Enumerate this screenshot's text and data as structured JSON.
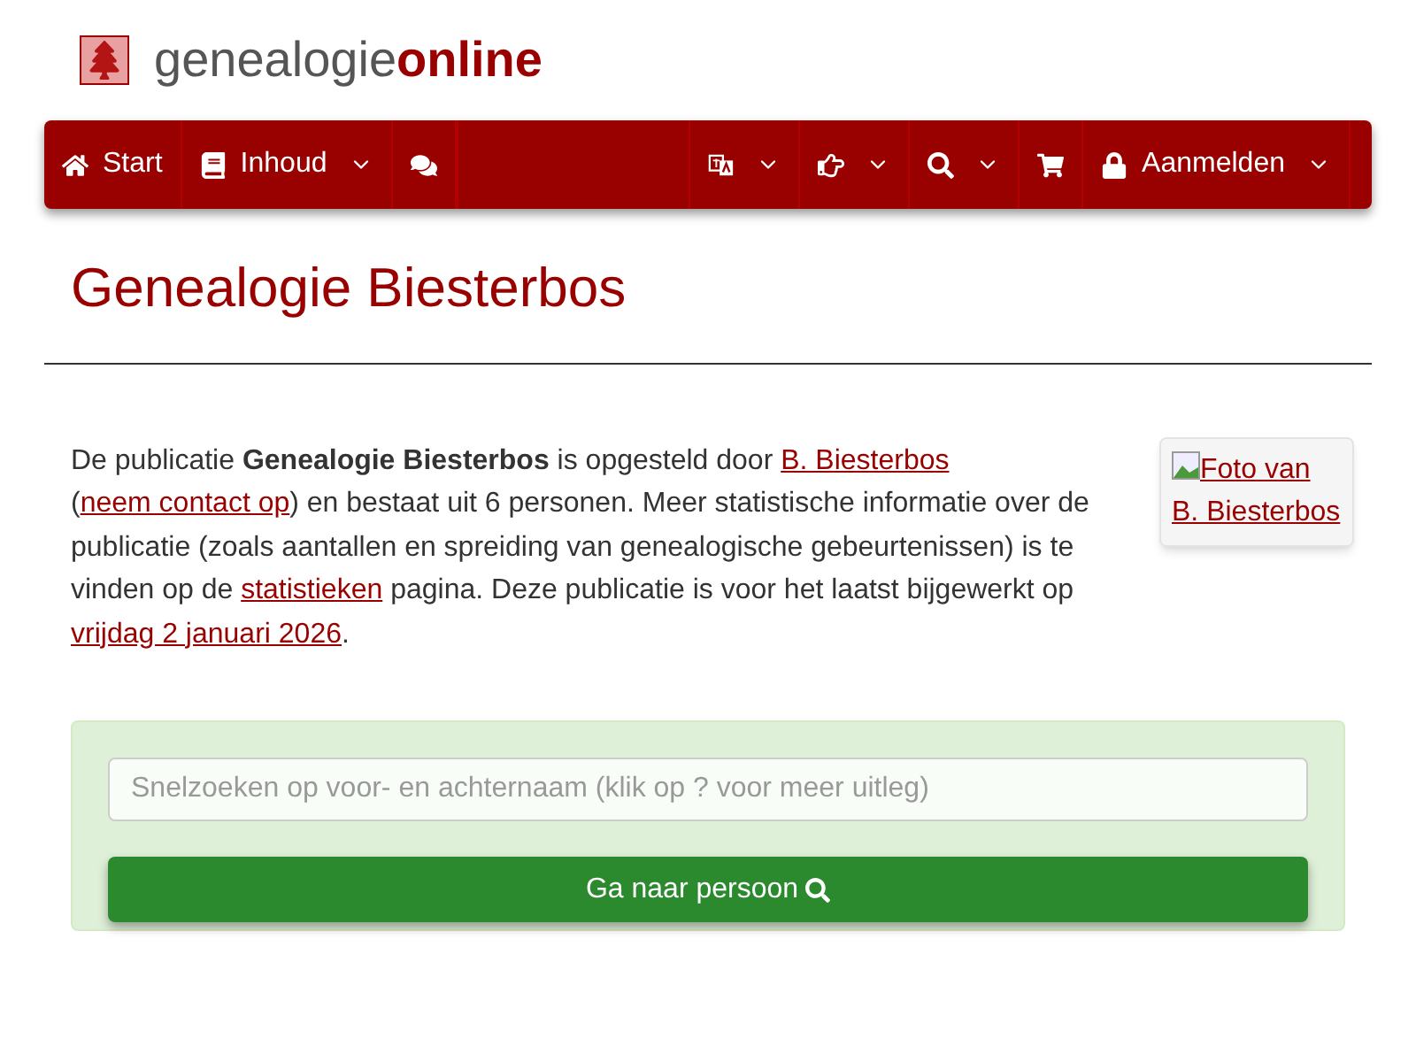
{
  "logo": {
    "text_plain": "genealogie",
    "text_bold": "online"
  },
  "nav_left": [
    {
      "kind": "home",
      "label": "Start",
      "dropdown": false
    },
    {
      "kind": "book",
      "label": "Inhoud",
      "dropdown": true
    },
    {
      "kind": "comments",
      "dropdown": false
    }
  ],
  "nav_right": [
    {
      "kind": "language",
      "dropdown": true
    },
    {
      "kind": "hand",
      "dropdown": true
    },
    {
      "kind": "search",
      "dropdown": true
    },
    {
      "kind": "cart",
      "dropdown": false
    },
    {
      "kind": "lock",
      "label": "Aanmelden",
      "dropdown": true
    }
  ],
  "title": "Genealogie Biesterbos",
  "intro": [
    {
      "kind": "text",
      "text": "De publicatie "
    },
    {
      "kind": "bold",
      "text": "Genealogie Biesterbos"
    },
    {
      "kind": "text",
      "text": " is opgesteld door "
    },
    {
      "kind": "link",
      "text": "B. Biesterbos"
    },
    {
      "kind": "text",
      "text": " ("
    },
    {
      "kind": "link",
      "text": "neem contact op"
    },
    {
      "kind": "text",
      "text": ") en bestaat uit 6 personen. Meer statistische informatie over de publicatie (zoals aantallen en spreiding van genealogische gebeurtenissen) is te vinden op de "
    },
    {
      "kind": "link",
      "text": "statistieken"
    },
    {
      "kind": "text",
      "text": " pagina. Deze publicatie is voor het laatst bijgewerkt op "
    },
    {
      "kind": "link",
      "text": "vrijdag 2 januari 2026"
    },
    {
      "kind": "text",
      "text": "."
    }
  ],
  "photo": {
    "alt": "Foto van B. Biesterbos"
  },
  "search": {
    "placeholder": "Snelzoeken op voor- en achternaam (klik op ? voor meer uitleg)",
    "button": "Ga naar persoon"
  }
}
